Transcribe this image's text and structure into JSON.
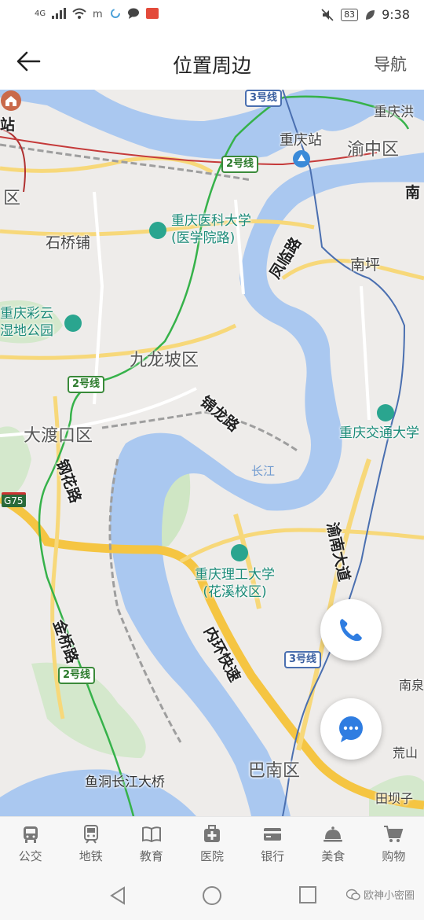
{
  "status": {
    "net": "4G",
    "battery": "83",
    "time": "9:38"
  },
  "header": {
    "title": "位置周边",
    "nav_label": "导航"
  },
  "map": {
    "districts": [
      "渝中区",
      "九龙坡区",
      "大渡口区",
      "巴南区"
    ],
    "places": [
      "石桥铺",
      "南坪",
      "重庆站",
      "重庆洪",
      "荒山",
      "南泉",
      "田坝子",
      "区",
      "南"
    ],
    "roads": [
      "凤临路",
      "锦龙路",
      "钢花路",
      "金桥路",
      "渝南大道",
      "内环快速",
      "鱼洞长江大桥",
      "站"
    ],
    "pois": [
      {
        "name": "重庆医科大学",
        "sub": "(医学院路)"
      },
      {
        "name": "重庆彩云",
        "sub": "湿地公园"
      },
      {
        "name": "重庆交通大学",
        "sub": ""
      },
      {
        "name": "重庆理工大学",
        "sub": "(花溪校区)"
      }
    ],
    "water": "长江",
    "metro_tags": [
      "3号线",
      "2号线",
      "2号线",
      "2号线",
      "3号线"
    ],
    "highway_tag": "G75",
    "colors": {
      "water": "#aac8f0",
      "road_major": "#f5c542",
      "metro_green": "#36b24a",
      "metro_blue": "#4a6fb0",
      "poi_teal": "#2aa58f"
    }
  },
  "fab": {
    "phone_icon": "phone-icon",
    "chat_icon": "chat-icon"
  },
  "tabs": [
    {
      "label": "公交",
      "icon": "bus-icon"
    },
    {
      "label": "地铁",
      "icon": "subway-icon"
    },
    {
      "label": "教育",
      "icon": "book-icon"
    },
    {
      "label": "医院",
      "icon": "hospital-icon"
    },
    {
      "label": "银行",
      "icon": "card-icon"
    },
    {
      "label": "美食",
      "icon": "food-icon"
    },
    {
      "label": "购物",
      "icon": "cart-icon"
    }
  ],
  "watermark": "欧神小密圈"
}
